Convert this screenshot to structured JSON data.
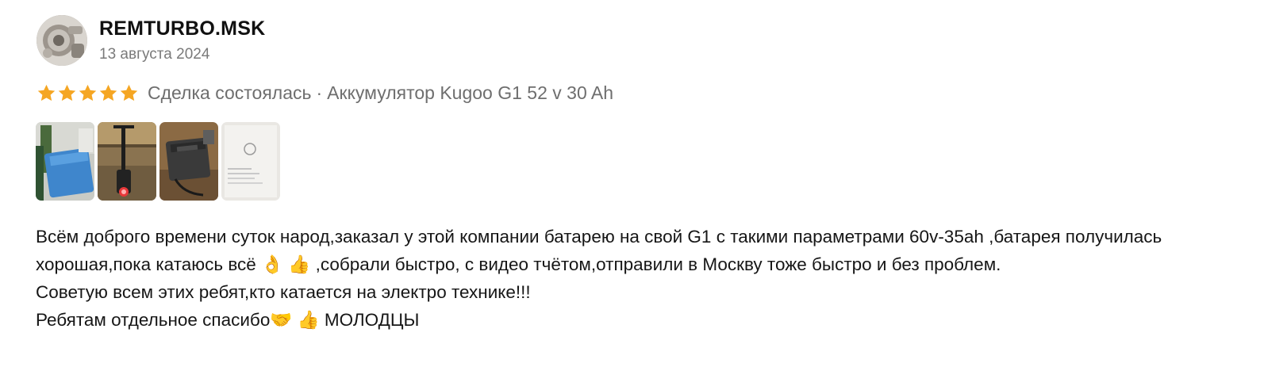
{
  "author": {
    "name": "REMTURBO.MSK",
    "date": "13 августа 2024"
  },
  "rating": {
    "stars": 5,
    "star_color": "#f5a623",
    "deal_status": "Сделка состоялась",
    "separator": "·",
    "product": "Аккумулятор Kugoo G1 52 v 30 Ah"
  },
  "photos": [
    {
      "name": "battery-pack-photo"
    },
    {
      "name": "scooter-photo"
    },
    {
      "name": "charger-photo"
    },
    {
      "name": "document-photo"
    }
  ],
  "review": {
    "paragraph1": "Всём доброго времени суток народ,заказал у этой компании батарею на свой G1 с такими параметрами 60v-35ah ,батарея получилась хорошая,пока катаюсь всё 👌 👍 ,собрали быстро, с видео тчётом,отправили в Москву тоже быстро и без проблем.",
    "paragraph2": "Советую всем этих ребят,кто катается на электро технике!!!",
    "paragraph3": "Ребятам отдельное спасибо🤝 👍 МОЛОДЦЫ"
  }
}
